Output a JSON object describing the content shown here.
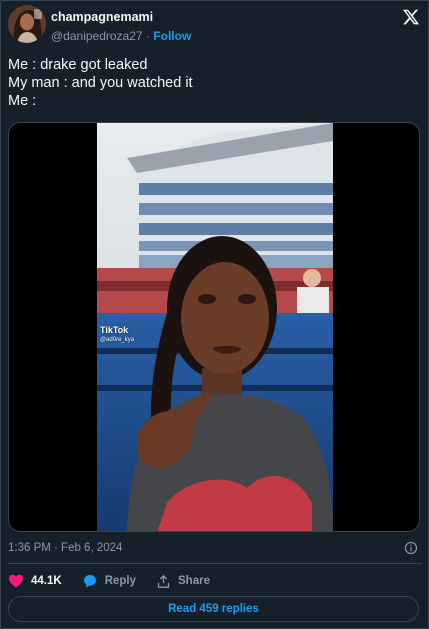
{
  "author": {
    "display_name": "champagnemami",
    "handle": "@danipedroza27",
    "separator": "·",
    "follow_label": "Follow"
  },
  "tweet": {
    "lines": [
      "Me : drake got leaked",
      "My man : and you watched it",
      "Me :"
    ]
  },
  "media": {
    "type": "video",
    "watermark": "TikTok",
    "watermark_user": "@ad0re_kya"
  },
  "meta": {
    "timestamp": "1:36 PM · Feb 6, 2024"
  },
  "actions": {
    "likes": "44.1K",
    "reply_label": "Reply",
    "share_label": "Share"
  },
  "replies_button": "Read 459 replies",
  "colors": {
    "background": "#15202b",
    "accent": "#1d9bf0",
    "like": "#f91880",
    "border": "#38444d",
    "muted": "#8b98a5"
  },
  "icons": [
    "x-logo-icon",
    "heart-icon",
    "reply-bubble-icon",
    "share-icon",
    "info-icon"
  ]
}
